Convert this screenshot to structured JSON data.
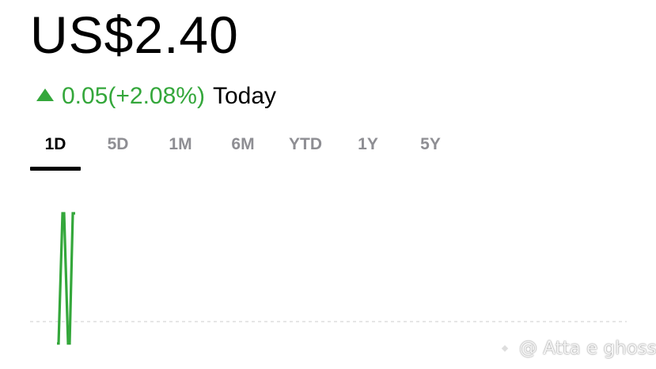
{
  "quote": {
    "price": "US$2.40",
    "change": "0.05(+2.08%)",
    "change_period": "Today",
    "change_direction": "up",
    "up_color": "#34a73b"
  },
  "range_tabs": {
    "items": [
      "1D",
      "5D",
      "1M",
      "6M",
      "YTD",
      "1Y",
      "5Y"
    ],
    "selected": "1D"
  },
  "chart_data": {
    "type": "line",
    "series": [
      {
        "values": [
          2.35,
          2.35,
          2.42,
          2.42,
          2.35,
          2.35,
          2.42,
          2.42
        ],
        "color": "#34a73b"
      }
    ],
    "reference_line": {
      "value": 2.35,
      "style": "dashed"
    },
    "grid": false
  },
  "watermark": {
    "text": "@ Atta e ghoss"
  }
}
